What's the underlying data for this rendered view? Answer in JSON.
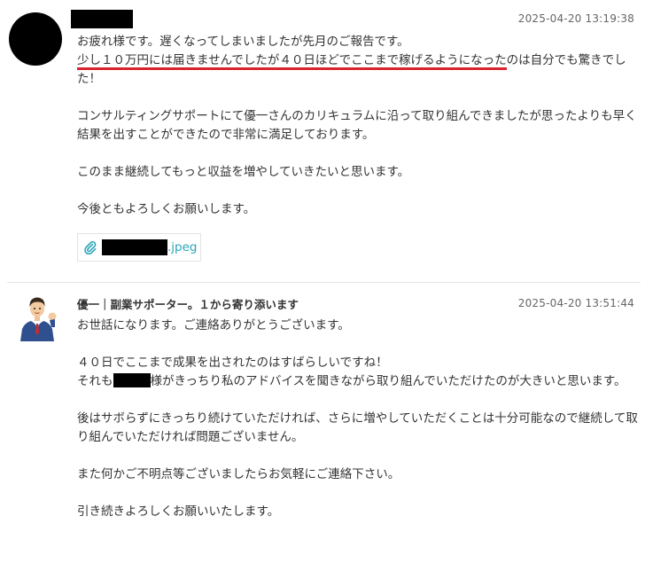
{
  "message1": {
    "timestamp": "2025-04-20 13:19:38",
    "line1": "お疲れ様です。遅くなってしまいましたが先月のご報告です。",
    "line2_underlined": "少し１０万円には届きませんでしたが４０日ほどでここまで稼げるようになった",
    "line2_rest": "のは自分でも驚きでした！",
    "para2": "コンサルティングサポートにて優一さんのカリキュラムに沿って取り組んできましたが思ったよりも早く結果を出すことができたので非常に満足しております。",
    "para3": "このまま継続してもっと収益を増やしていきたいと思います。",
    "para4": "今後ともよろしくお願いします。",
    "attachment_ext": ".jpeg",
    "attachment_icon": "paperclip-icon",
    "underline_color": "#d9232e"
  },
  "message2": {
    "sender": "優一｜副業サポーター。１から寄り添います",
    "timestamp": "2025-04-20 13:51:44",
    "para1": "お世話になります。ご連絡ありがとうございます。",
    "para2_line1": "４０日でここまで成果を出されたのはすばらしいですね！",
    "para2_line2_pre": "それも",
    "para2_line2_post": "様がきっちり私のアドバイスを聞きながら取り組んでいただけたのが大きいと思います。",
    "para3": "後はサボらずにきっちり続けていただければ、さらに増やしていただくことは十分可能なので継続して取り組んでいただければ問題ございません。",
    "para4": "また何かご不明点等ございましたらお気軽にご連絡下さい。",
    "para5": "引き続きよろしくお願いいたします。"
  },
  "colors": {
    "link_teal": "#2aa5b8",
    "text": "#333333",
    "timestamp": "#666666"
  }
}
